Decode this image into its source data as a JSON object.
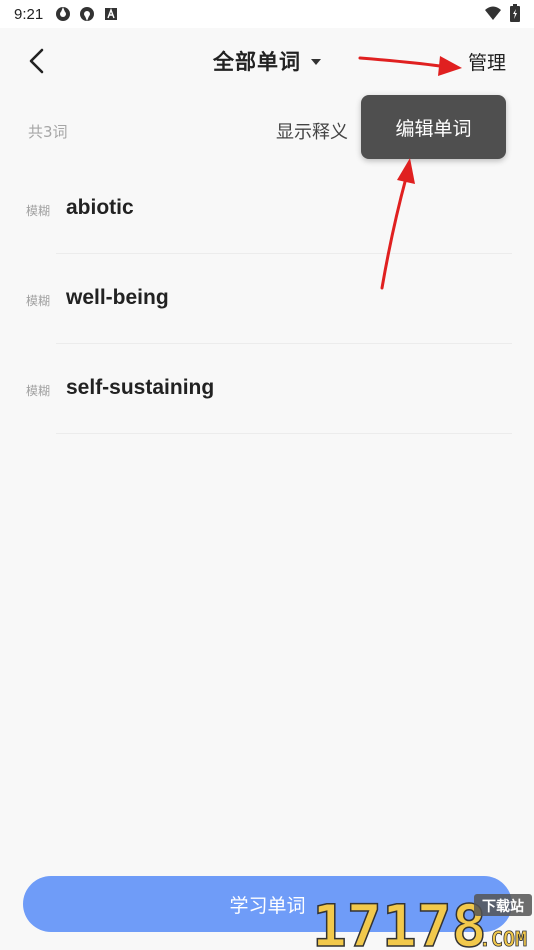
{
  "status_bar": {
    "time": "9:21"
  },
  "header": {
    "title": "全部单词",
    "manage_label": "管理"
  },
  "subbar": {
    "count_label": "共3词",
    "show_meaning_label": "显示释义"
  },
  "popup": {
    "edit_words_label": "编辑单词"
  },
  "words": [
    {
      "blur_label": "模糊",
      "word": "abiotic"
    },
    {
      "blur_label": "模糊",
      "word": "well-being"
    },
    {
      "blur_label": "模糊",
      "word": "self-sustaining"
    }
  ],
  "footer": {
    "study_label": "学习单词"
  },
  "watermark": {
    "number": "17178",
    "site": "下载站",
    "domain": ".COM"
  },
  "colors": {
    "accent": "#6f9cf8",
    "popup_bg": "#4f4f4f",
    "arrow": "#e02020"
  }
}
